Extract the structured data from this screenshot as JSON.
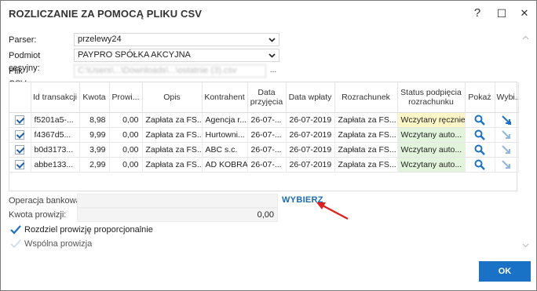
{
  "window": {
    "title": "ROZLICZANIE ZA POMOCĄ PLIKU CSV",
    "help_label": "?",
    "maximize_label": "☐",
    "close_label": "✕"
  },
  "form": {
    "parser_label": "Parser:",
    "parser_value": "przelewy24",
    "podmiot_label": "Podmiot cesyjny:",
    "podmiot_value": "PAYPRO SPÓŁKA AKCYJNA",
    "plik_label": "Plik CSV:",
    "plik_value": "C:\\Users\\...\\Downloads\\...\\ostatnie (3).csv",
    "plik_button": "..."
  },
  "table": {
    "headers": {
      "id": "Id transakcji",
      "kwota": "Kwota",
      "prowizja": "Prowi...",
      "opis": "Opis",
      "kontrahent": "Kontrahent",
      "data_przyjecia": "Data przyjęcia",
      "data_wplaty": "Data wpłaty",
      "rozrachunek": "Rozrachunek",
      "status": "Status podpięcia rozrachunku",
      "pokaz": "Pokaż",
      "wybierz": "Wybi..."
    },
    "rows": [
      {
        "id": "f5201a5-...",
        "kwota": "8,98",
        "prowizja": "0,00",
        "opis": "Zapłata za FS...",
        "kontrahent": "Agencja r...",
        "data_przyjecia": "26-07-...",
        "data_wplaty": "26-07-2019",
        "rozrachunek": "Zapłata za FS...",
        "status": "Wczytany ręcznie"
      },
      {
        "id": "f4367d5...",
        "kwota": "9,99",
        "prowizja": "0,00",
        "opis": "Zapłata za FS...",
        "kontrahent": "Hurtowni...",
        "data_przyjecia": "26-07-...",
        "data_wplaty": "26-07-2019",
        "rozrachunek": "Zapłata za FS...",
        "status": "Wczytany auto..."
      },
      {
        "id": "b0d3173...",
        "kwota": "3,99",
        "prowizja": "0,00",
        "opis": "Zapłata za FS...",
        "kontrahent": "ABC s.c.",
        "data_przyjecia": "26-07-...",
        "data_wplaty": "26-07-2019",
        "rozrachunek": "Zapłata za FS...",
        "status": "Wczytany auto..."
      },
      {
        "id": "abbe133...",
        "kwota": "2,99",
        "prowizja": "0,00",
        "opis": "Zapłata za FS...",
        "kontrahent": "AD KOBRA",
        "data_przyjecia": "26-07-...",
        "data_wplaty": "26-07-2019",
        "rozrachunek": "Zapłata za FS...",
        "status": "Wczytany auto..."
      }
    ]
  },
  "bottom": {
    "operacja_label": "Operacja bankowa:",
    "operacja_value": "",
    "wybierz_link": "WYBIERZ",
    "kwota_prowizji_label": "Kwota prowizji:",
    "kwota_prowizji_value": "0,00",
    "rozdziel_label": "Rozdziel prowizję proporcjonalnie",
    "wspolna_label": "Wspólna prowizja",
    "ok_button": "OK"
  },
  "colors": {
    "accent": "#1a72c6",
    "link": "#1a6bb5",
    "status_manual": "#fff6c8",
    "status_auto": "#e3f4dc",
    "annotation_arrow": "#e02020"
  }
}
